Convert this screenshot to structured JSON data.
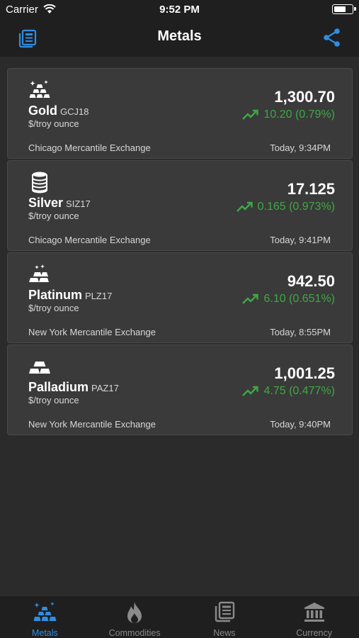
{
  "status_bar": {
    "carrier": "Carrier",
    "time": "9:52 PM",
    "battery_level": 0.7
  },
  "nav": {
    "title": "Metals",
    "left_icon": "news-list-icon",
    "right_icon": "share-icon"
  },
  "colors": {
    "accent": "#2f8de4",
    "positive": "#3fa845",
    "card_bg": "#3a3a3a",
    "background": "#2b2b2b"
  },
  "metals": [
    {
      "icon": "gold-bars-icon",
      "name": "Gold",
      "symbol": "GCJ18",
      "unit": "$/troy ounce",
      "exchange": "Chicago Mercantile Exchange",
      "price": "1,300.70",
      "change": "10.20 (0.79%)",
      "updated": "Today, 9:34PM"
    },
    {
      "icon": "silver-coins-icon",
      "name": "Silver",
      "symbol": "SIZ17",
      "unit": "$/troy ounce",
      "exchange": "Chicago Mercantile Exchange",
      "price": "17.125",
      "change": "0.165 (0.973%)",
      "updated": "Today, 9:41PM"
    },
    {
      "icon": "platinum-bars-icon",
      "name": "Platinum",
      "symbol": "PLZ17",
      "unit": "$/troy ounce",
      "exchange": "New York Mercantile Exchange",
      "price": "942.50",
      "change": "6.10 (0.651%)",
      "updated": "Today, 8:55PM"
    },
    {
      "icon": "palladium-bars-icon",
      "name": "Palladium",
      "symbol": "PAZ17",
      "unit": "$/troy ounce",
      "exchange": "New York Mercantile Exchange",
      "price": "1,001.25",
      "change": "4.75 (0.477%)",
      "updated": "Today, 9:40PM"
    }
  ],
  "tabs": [
    {
      "label": "Metals",
      "icon": "metals-icon",
      "active": true
    },
    {
      "label": "Commodities",
      "icon": "flame-icon",
      "active": false
    },
    {
      "label": "News",
      "icon": "newspaper-icon",
      "active": false
    },
    {
      "label": "Currency",
      "icon": "bank-icon",
      "active": false
    }
  ]
}
